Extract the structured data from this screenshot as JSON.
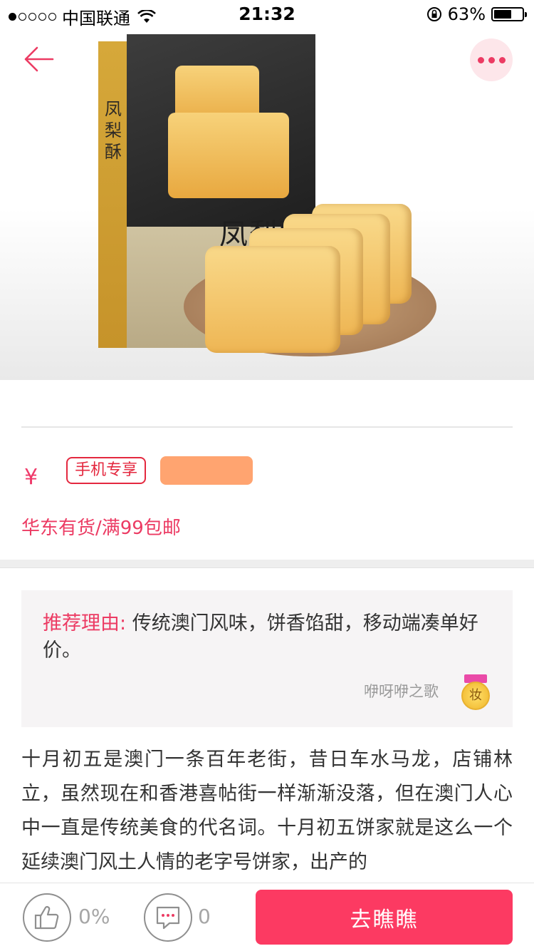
{
  "status_bar": {
    "carrier": "中国联通",
    "time": "21:32",
    "battery": "63%",
    "battery_level": 0.63
  },
  "header": {
    "back_icon": "back-arrow-icon",
    "more_icon": "more-dots-icon"
  },
  "product": {
    "box_title": "凤梨酥",
    "box_side_text": "凤梨酥",
    "currency": "¥",
    "tag_mobile": "手机专享",
    "shipping": "华东有货/满99包邮"
  },
  "recommendation": {
    "label": "推荐理由:",
    "text": "传统澳门风味，饼香馅甜，移动端凑单好价。",
    "author": "咿呀咿之歌",
    "badge_char": "妆"
  },
  "article": {
    "text": "十月初五是澳门一条百年老街，昔日车水马龙，店铺林立，虽然现在和香港喜帖街一样渐渐没落，但在澳门人心中一直是传统美食的代名词。十月初五饼家就是这么一个延续澳门风土人情的老字号饼家，出产的"
  },
  "bottom_bar": {
    "like_icon": "thumbs-up-icon",
    "like_count": "0%",
    "comment_icon": "comment-icon",
    "comment_count": "0",
    "go_label": "去瞧瞧"
  },
  "colors": {
    "accent": "#ec3b63",
    "button": "#fc3a62",
    "tag_orange": "#ffa470"
  }
}
